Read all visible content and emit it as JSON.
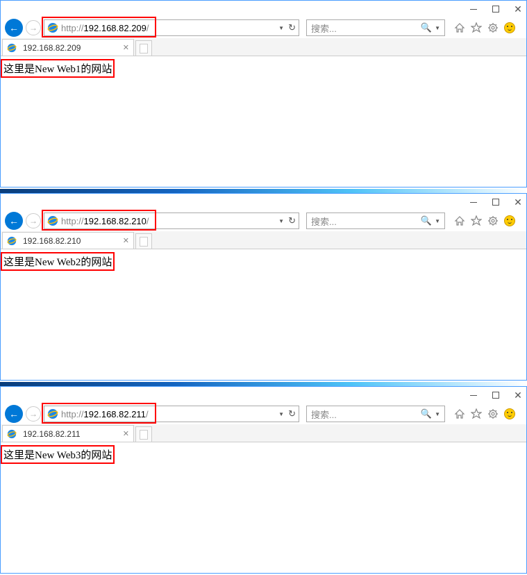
{
  "windows": [
    {
      "url_prefix": "http://",
      "url_host": "192.168.82.209",
      "url_suffix": "/",
      "tab_title": "192.168.82.209",
      "page_text": "这里是New Web1的网站",
      "search_placeholder": "搜索..."
    },
    {
      "url_prefix": "http://",
      "url_host": "192.168.82.210",
      "url_suffix": "/",
      "tab_title": "192.168.82.210",
      "page_text": "这里是New Web2的网站",
      "search_placeholder": "搜索..."
    },
    {
      "url_prefix": "http://",
      "url_host": "192.168.82.211",
      "url_suffix": "/",
      "tab_title": "192.168.82.211",
      "page_text": "这里是New Web3的网站",
      "search_placeholder": "搜索..."
    }
  ]
}
